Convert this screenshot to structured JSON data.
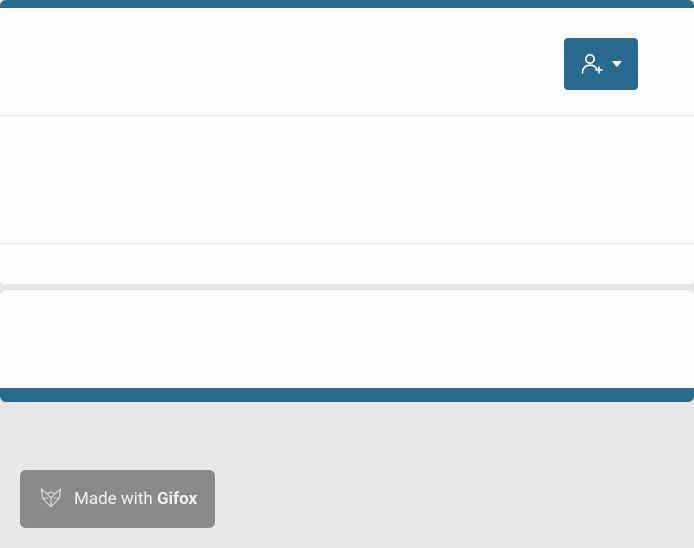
{
  "colors": {
    "accent": "#2b6a8f",
    "background": "#e8e8e8",
    "surface": "#fdfdfd",
    "watermark_bg": "#8a8a8a",
    "watermark_text": "#f2f2f2"
  },
  "header": {
    "user_button": {
      "icon": "add-user-icon",
      "has_dropdown": true
    }
  },
  "watermark": {
    "prefix": "Made with ",
    "brand": "Gifox",
    "icon": "fox-icon"
  }
}
